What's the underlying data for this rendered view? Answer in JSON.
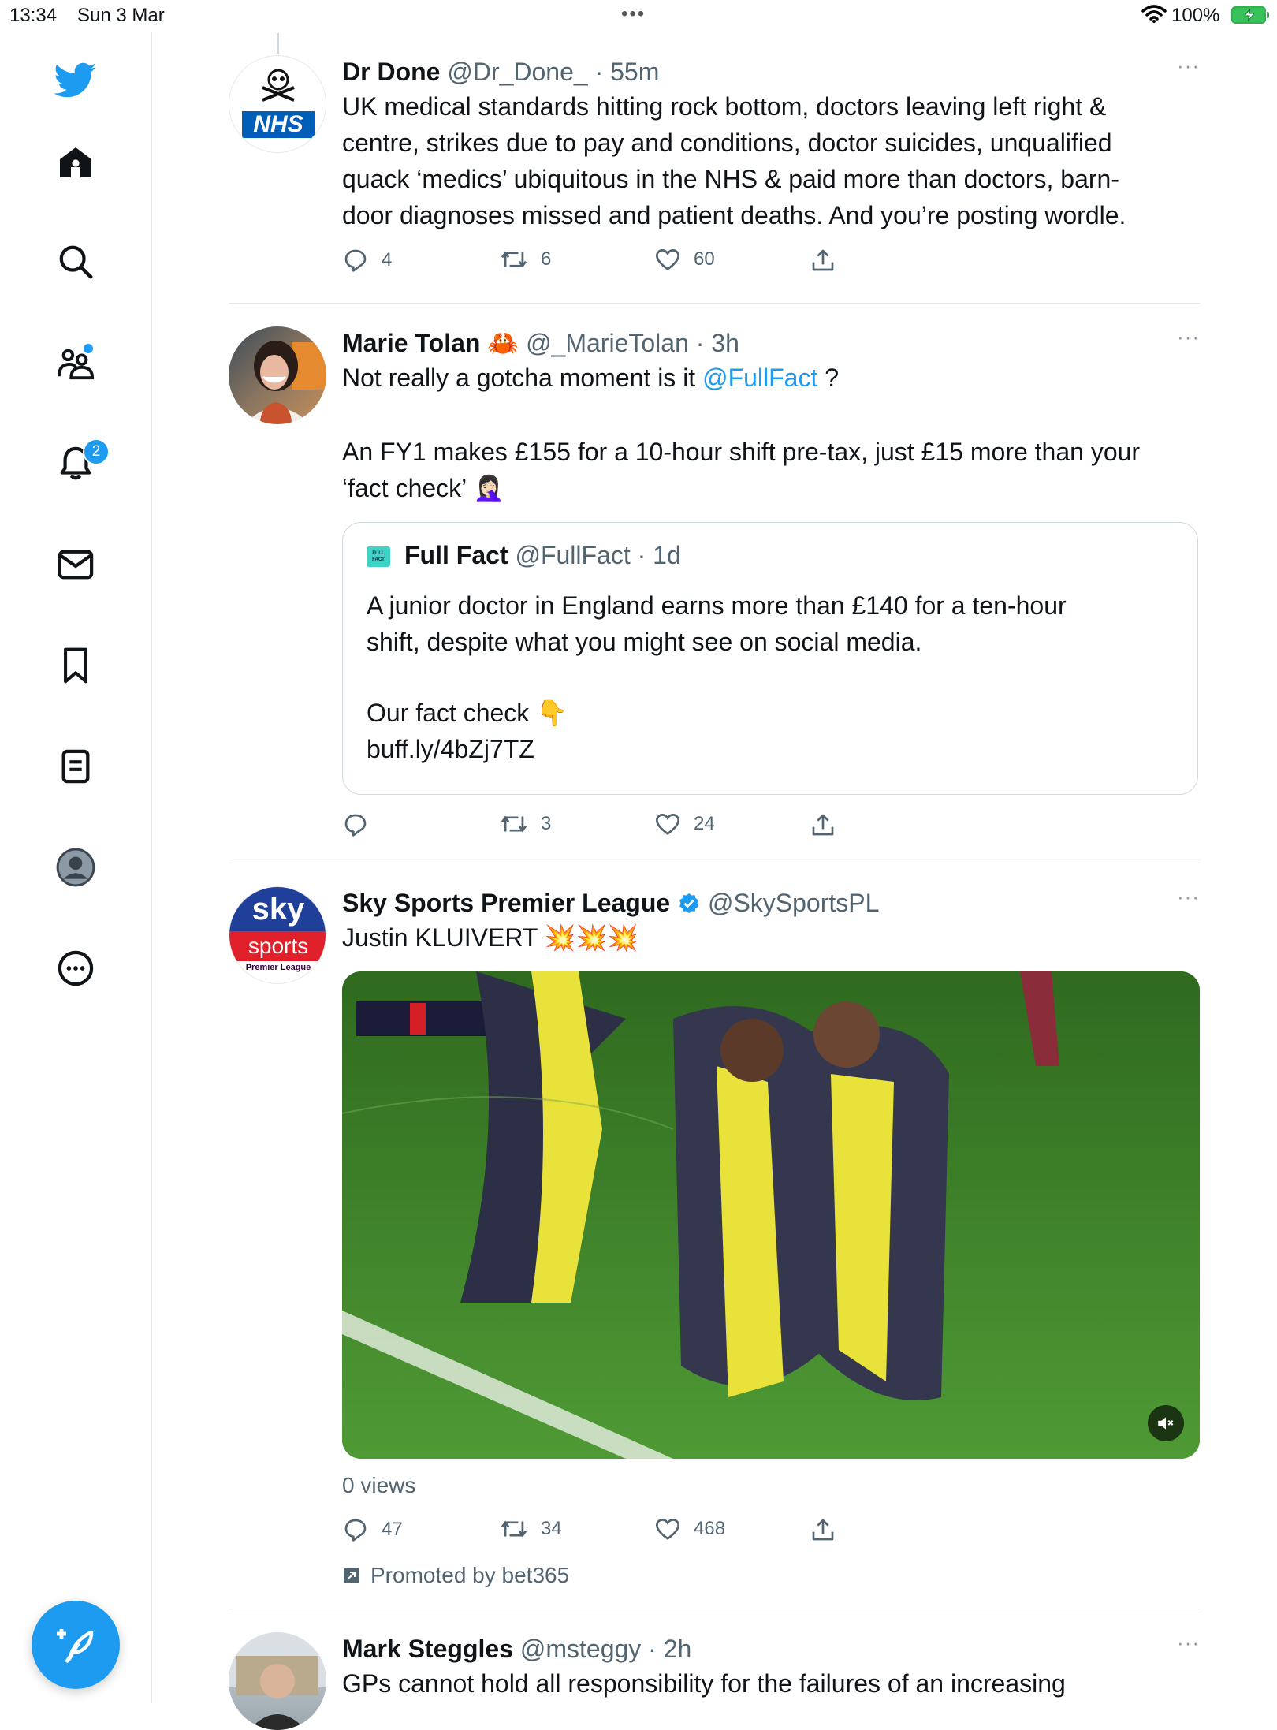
{
  "status_bar": {
    "time": "13:34",
    "date": "Sun 3 Mar",
    "battery": "100%"
  },
  "sidebar": {
    "items": [
      "twitter-logo",
      "home",
      "explore",
      "communities",
      "notifications",
      "messages",
      "bookmarks",
      "lists",
      "profile",
      "more"
    ],
    "notification_badge": "2"
  },
  "tweets": [
    {
      "name": "Dr Done",
      "handle": "@Dr_Done_",
      "time": "· 55m",
      "avatar_text": "NHS",
      "text_lines": [
        "UK medical standards hitting rock bottom, doctors leaving left right &",
        "centre, strikes due to pay and conditions, doctor suicides, unqualified",
        "quack ‘medics’ ubiquitous in the NHS & paid more than doctors, barn-",
        "door diagnoses missed and patient deaths. And you’re posting wordle."
      ],
      "replies": "4",
      "retweets": "6",
      "likes": "60"
    },
    {
      "name": "Marie Tolan",
      "name_emoji": "🦀",
      "handle": "@_MarieTolan",
      "time": "· 3h",
      "text_prefix": "Not really a gotcha moment is it ",
      "mention": "@FullFact",
      "text_suffix": " ?",
      "text2_line1": "An FY1 makes £155 for a 10-hour shift pre-tax, just £15 more than your",
      "text2_line2": "‘fact check’ 🤦🏻‍♀️",
      "quote": {
        "name": "Full Fact",
        "handle": "@FullFact",
        "time": "· 1d",
        "logo_text": "FULL FACT",
        "line1": "A junior doctor in England earns more than £140 for a ten-hour",
        "line2": "shift, despite what you might see on social media.",
        "line3": "Our fact check  👇",
        "link": "buff.ly/4bZj7TZ"
      },
      "replies": "",
      "retweets": "3",
      "likes": "24"
    },
    {
      "name": "Sky Sports Premier League",
      "handle": "@SkySportsPL",
      "text": "Justin KLUIVERT 💥💥💥",
      "avatar_sky": "sky",
      "avatar_sports": "sports",
      "avatar_league": "Premier League",
      "views": "0 views",
      "replies": "47",
      "retweets": "34",
      "likes": "468",
      "promoted": "Promoted by bet365"
    },
    {
      "name": "Mark Steggles",
      "handle": "@msteggy",
      "time": "· 2h",
      "text": "GPs cannot hold all responsibility for the failures of an increasing"
    }
  ],
  "more_label": "···"
}
